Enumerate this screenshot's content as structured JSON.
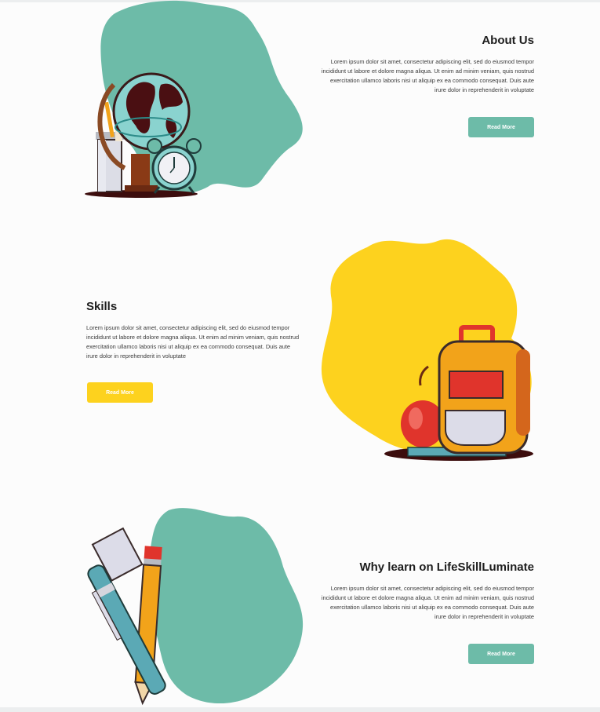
{
  "colors": {
    "teal": "#6dbba8",
    "yellow": "#fdd21e",
    "background": "#fcfcfc"
  },
  "sections": [
    {
      "title": "About Us",
      "body": "Lorem ipsum dolor sit amet, consectetur adipiscing elit, sed do eiusmod tempor incididunt ut labore et dolore magna aliqua. Ut enim ad minim veniam, quis nostrud exercitation ullamco laboris nisi ut aliquip ex ea commodo consequat. Duis aute irure dolor in reprehenderit in voluptate",
      "button_label": "Read More",
      "illustration": "globe-and-clock-icon"
    },
    {
      "title": "Skills",
      "body": "Lorem ipsum dolor sit amet, consectetur adipiscing elit, sed do eiusmod tempor incididunt ut labore et dolore magna aliqua. Ut enim ad minim veniam, quis nostrud exercitation ullamco laboris nisi ut aliquip ex ea commodo consequat. Duis aute irure dolor in reprehenderit in voluptate",
      "button_label": "Read More",
      "illustration": "backpack-and-apple-icon"
    },
    {
      "title": "Why learn on LifeSkillLuminate",
      "body": "Lorem ipsum dolor sit amet, consectetur adipiscing elit, sed do eiusmod tempor incididunt ut labore et dolore magna aliqua. Ut enim ad minim veniam, quis nostrud exercitation ullamco laboris nisi ut aliquip ex ea commodo consequat. Duis aute irure dolor in reprehenderit in voluptate",
      "button_label": "Read More",
      "illustration": "pencil-and-pen-icon"
    }
  ]
}
